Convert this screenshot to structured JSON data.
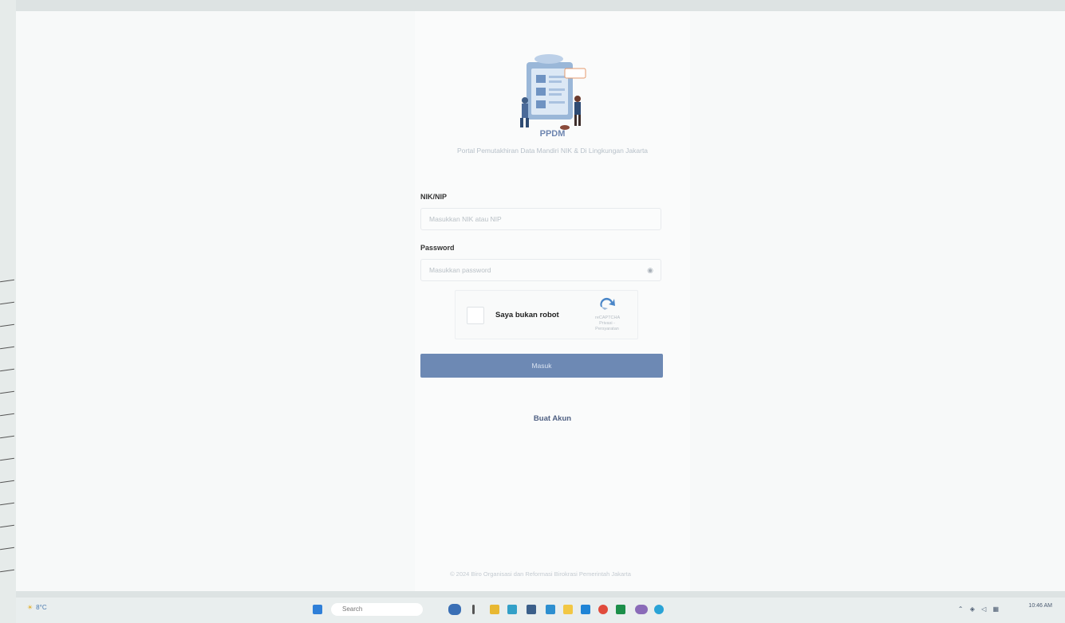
{
  "login": {
    "brand": "PPDM",
    "subtitle": "Portal Pemutakhiran Data Mandiri NIK & Di Lingkungan Jakarta",
    "nik_label": "NIK/NIP",
    "nik_placeholder": "Masukkan NIK atau NIP",
    "password_label": "Password",
    "password_placeholder": "Masukkan password",
    "captcha_label": "Saya bukan robot",
    "captcha_brand": "reCAPTCHA",
    "captcha_links": "Privasi - Persyaratan",
    "login_button": "Masuk",
    "create_account": "Buat Akun"
  },
  "footer": {
    "text": "© 2024 Biro Organisasi dan Reformasi Birokrasi Pemerintah Jakarta"
  },
  "taskbar": {
    "weather": "8°C",
    "search_placeholder": "Search",
    "clock_time": "10:46 AM"
  },
  "colors": {
    "accent": "#6d89b4",
    "brand": "#6e86b0",
    "link": "#4e5f82"
  }
}
